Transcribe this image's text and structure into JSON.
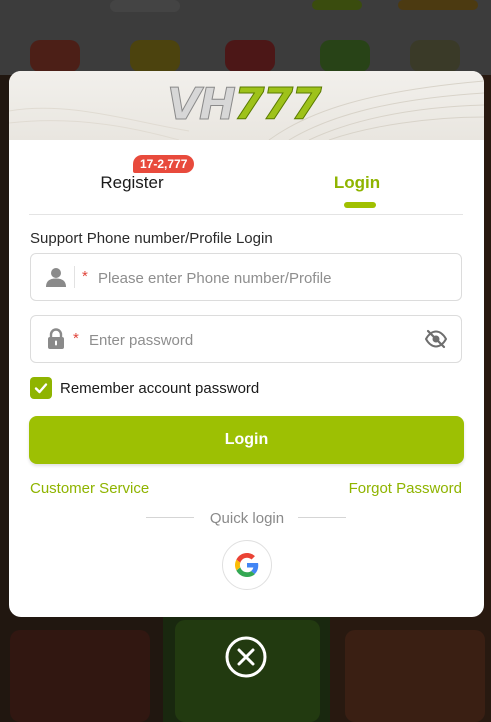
{
  "brand": {
    "logo_letters": "VH",
    "logo_digits": "777",
    "accent_color": "#9dc003"
  },
  "tabs": [
    {
      "label": "Register",
      "badge": "17-2,777",
      "active": false
    },
    {
      "label": "Login",
      "active": true
    }
  ],
  "form": {
    "title": "Support Phone number/Profile Login",
    "phone": {
      "required_mark": "*",
      "placeholder": "Please enter Phone number/Profile",
      "value": "",
      "icon": "user-icon"
    },
    "password": {
      "required_mark": "*",
      "placeholder": "Enter password",
      "value": "",
      "icon": "lock-icon",
      "toggle_icon": "eye-off-icon"
    },
    "remember": {
      "label": "Remember account password",
      "checked": true
    }
  },
  "actions": {
    "login_label": "Login",
    "customer_service": "Customer Service",
    "forgot_password": "Forgot Password"
  },
  "quick_login": {
    "label": "Quick login",
    "providers": [
      "google-icon"
    ]
  },
  "close_icon": "close-icon"
}
